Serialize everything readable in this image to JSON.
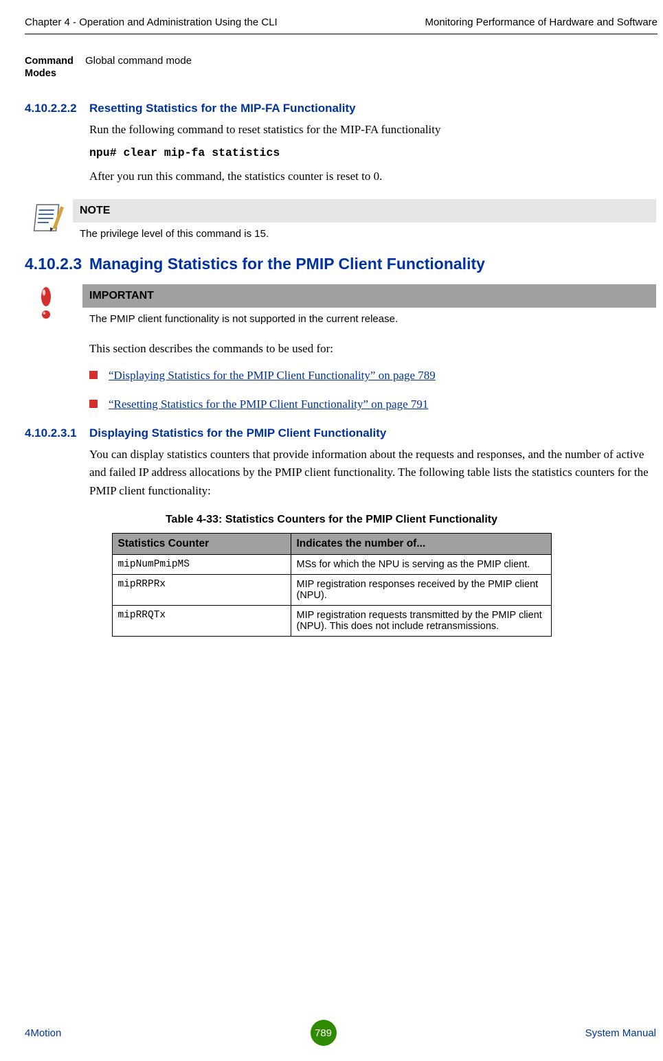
{
  "header": {
    "left": "Chapter 4 - Operation and Administration Using the CLI",
    "right": "Monitoring Performance of Hardware and Software"
  },
  "command_modes": {
    "label_line1": "Command",
    "label_line2": "Modes",
    "value": "Global command mode"
  },
  "section_41022_2": {
    "num": "4.10.2.2.2",
    "title": "Resetting Statistics for the MIP-FA Functionality",
    "p1": "Run the following command to reset statistics for the MIP-FA functionality",
    "cmd": "npu# clear mip-fa statistics",
    "p2": "After you run this command, the statistics counter is reset to 0."
  },
  "note1": {
    "title": "NOTE",
    "body": "The privilege level of this command is 15."
  },
  "section_4102_3": {
    "num": "4.10.2.3",
    "title": "Managing Statistics for the PMIP Client Functionality"
  },
  "important1": {
    "title": "IMPORTANT",
    "body": "The PMIP client functionality is not supported in the current release."
  },
  "section_4102_3_intro": "This section describes the commands to be used for:",
  "links": {
    "l1": "“Displaying Statistics for the PMIP Client Functionality” on page 789",
    "l2": "“Resetting Statistics for the PMIP Client Functionality” on page 791"
  },
  "section_41023_1": {
    "num": "4.10.2.3.1",
    "title": "Displaying Statistics for the PMIP Client Functionality",
    "p1": "You can display statistics counters that provide information about the requests and responses, and the number of active and failed IP address allocations by the PMIP client functionality. The following table lists the statistics counters for the PMIP client functionality:"
  },
  "table": {
    "caption": "Table 4-33: Statistics Counters for the PMIP Client Functionality",
    "head": {
      "c1": "Statistics Counter",
      "c2": "Indicates the number of..."
    },
    "rows": [
      {
        "counter": "mipNumPmipMS",
        "desc": "MSs for which the NPU is serving as the PMIP client."
      },
      {
        "counter": "mipRRPRx",
        "desc": "MIP registration responses received by the PMIP client (NPU)."
      },
      {
        "counter": "mipRRQTx",
        "desc": "MIP registration requests transmitted by the PMIP client (NPU). This does not include retransmissions."
      }
    ]
  },
  "footer": {
    "left": "4Motion",
    "page": "789",
    "right": "System Manual"
  }
}
